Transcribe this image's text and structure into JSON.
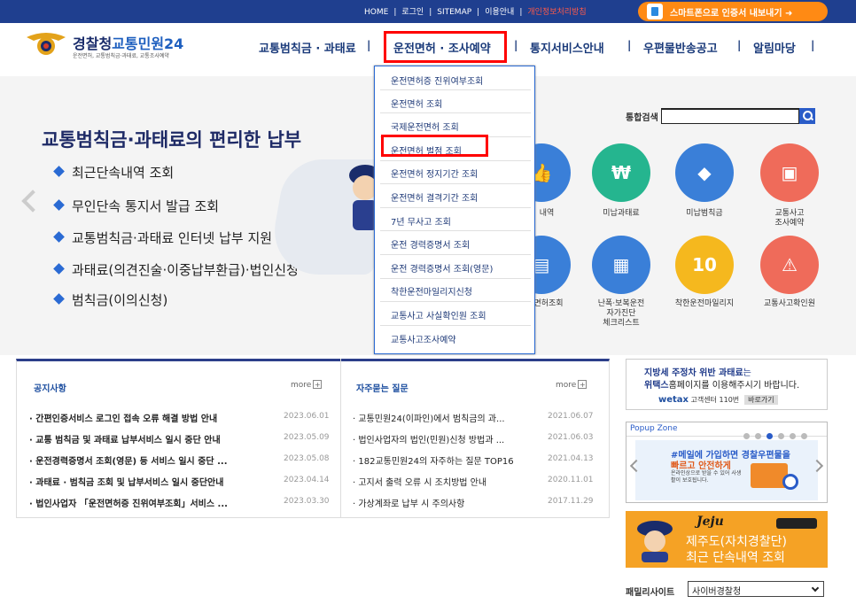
{
  "topbar": {
    "links": [
      "HOME",
      "로그인",
      "SITEMAP",
      "이용안내",
      "개인정보처리방침"
    ],
    "separators": [
      "|",
      "|",
      "|",
      "|"
    ],
    "smart_button": "스마트폰으로 인증서 내보내기"
  },
  "header": {
    "logo_title": "경찰청",
    "logo_brand": "교통민원24",
    "logo_sub": "운전면허, 교통범칙금·과태료, 교통조사예약",
    "nav": [
      "교통범칙금 · 과태료",
      "운전면허 · 조사예약",
      "통지서비스안내",
      "우편물반송공고",
      "알림마당"
    ],
    "nav_sep": "|"
  },
  "dropdown": [
    "운전면허증 진위여부조회",
    "운전면허 조회",
    "국제운전면허 조회",
    "운전면허 벌점 조회",
    "운전면허 정지기간 조회",
    "운전면허 결격기간 조회",
    "7년 무사고 조회",
    "운전 경력증명서 조회",
    "운전 경력증명서 조회(영문)",
    "착한운전마일리지신청",
    "교통사고 사실확인원 조회",
    "교통사고조사예약"
  ],
  "banner": {
    "title": "교통범칙금·과태료의 편리한 납부",
    "items": [
      "최근단속내역 조회",
      "무인단속 통지서 발급 조회",
      "교통범칙금·과태료 인터넷 납부 지원 등",
      "과태료(의견진술·이중납부환급)·법인신청",
      "범칙금(이의신청)"
    ]
  },
  "search": {
    "label": "통합검색",
    "value": ""
  },
  "quick_menu": [
    {
      "label": "내역",
      "icon": "thumbs-up-icon",
      "color": "#3a7fd8"
    },
    {
      "label": "미납과태료",
      "icon": "money-icon",
      "color": "#25b58f"
    },
    {
      "label": "미납범칙금",
      "icon": "warning-sign-icon",
      "color": "#3a7fd8"
    },
    {
      "label": "교통사고\n조사예약",
      "icon": "monitor-icon",
      "color": "#ef6b5a"
    },
    {
      "label": "면허조회",
      "icon": "license-card-icon",
      "color": "#3a7fd8"
    },
    {
      "label": "난폭·보복운전\n자가진단\n체크리스트",
      "icon": "calendar-check-icon",
      "color": "#3a7fd8"
    },
    {
      "label": "착한운전마일리지",
      "icon": "mileage-icon",
      "color": "#f5b81e"
    },
    {
      "label": "교통사고확인원",
      "icon": "car-crash-icon",
      "color": "#ef6b5a"
    }
  ],
  "notice": {
    "title": "공지사항",
    "more": "more",
    "rows": [
      {
        "text": "· 간편인증서비스 로그인 접속 오류 해결 방법 안내",
        "date": "2023.06.01"
      },
      {
        "text": "· 교통 범칙금 및 과태료 납부서비스 일시 중단 안내",
        "date": "2023.05.09"
      },
      {
        "text": "· 운전경력증명서 조회(영문) 등 서비스 일시 중단 ...",
        "date": "2023.05.08"
      },
      {
        "text": "· 과태료 · 범칙금 조회 및 납부서비스 일시 중단안내",
        "date": "2023.04.14"
      },
      {
        "text": "· 법인사업자 「운전면허증 진위여부조회」서비스 ...",
        "date": "2023.03.30"
      }
    ]
  },
  "faq": {
    "title": "자주묻는 질문",
    "more": "more",
    "rows": [
      {
        "text": "· 교통민원24(이파인)에서 범칙금의 과...",
        "date": "2021.06.07"
      },
      {
        "text": "· 법인사업자의 법인(민원)신청 방법과 ...",
        "date": "2021.06.03"
      },
      {
        "text": "· 182교통민원24의 자주하는 질문 TOP16",
        "date": "2021.04.13"
      },
      {
        "text": "· 고지서 출력 오류 시 조치방법 안내",
        "date": "2020.11.01"
      },
      {
        "text": "· 가상계좌로 납부 시 주의사항",
        "date": "2017.11.29"
      }
    ]
  },
  "ad": {
    "line1_b": "지방세 주정차 위반 과태료",
    "line1": "는",
    "line2_b": "위택스",
    "line2": "홈페이지를 이용해주시기 바랍니다.",
    "wtax": "wetax",
    "call": "고객센터 110번",
    "go": "바로가기"
  },
  "popup": {
    "title": "Popup Zone",
    "p1": "#메일에 가입하면 경찰우편물을",
    "p2": "빠르고 안전하게",
    "p3": "온라인상으로 받을 수 있어 사생활이 보호됩니다."
  },
  "jeju": {
    "logo": "Jeju",
    "line1": "제주도(자치경찰단)",
    "line2": "최근 단속내역 조회"
  },
  "family": {
    "label": "패밀리사이트",
    "selected": "사이버경찰청"
  }
}
